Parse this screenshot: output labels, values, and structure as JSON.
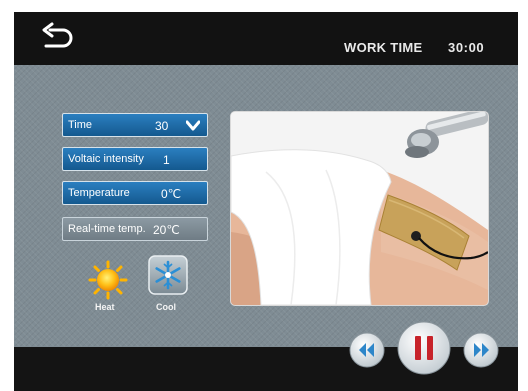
{
  "header": {
    "work_time_label": "WORK TIME",
    "work_time_value": "30:00",
    "back_icon": "back-arrow-icon"
  },
  "settings": {
    "time": {
      "label": "Time",
      "value": "30"
    },
    "voltaic_intensity": {
      "label": "Voltaic intensity",
      "value": "1"
    },
    "temperature": {
      "label": "Temperature",
      "value": "0℃"
    },
    "realtime_temp": {
      "label": "Real-time temp.",
      "value": "20℃"
    }
  },
  "modes": {
    "heat": {
      "label": "Heat",
      "icon": "sun-icon"
    },
    "cool": {
      "label": "Cool",
      "icon": "snowflake-icon"
    }
  },
  "controls": {
    "rewind_icon": "rewind-icon",
    "pause_icon": "pause-icon",
    "forward_icon": "fast-forward-icon"
  },
  "colors": {
    "field_blue": "#1f6fae",
    "panel": "#7f8c94",
    "pause_red": "#c7232a"
  }
}
